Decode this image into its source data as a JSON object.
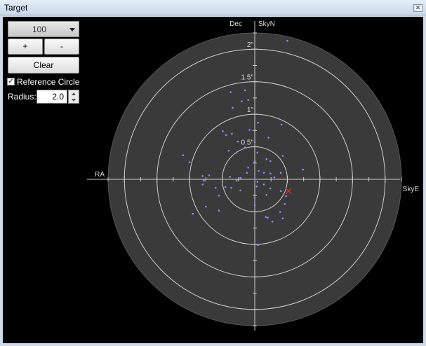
{
  "window": {
    "title": "Target",
    "close_glyph": "✕"
  },
  "controls": {
    "scale_value": "100",
    "plus_label": "+",
    "minus_label": "-",
    "clear_label": "Clear",
    "reference_checked": true,
    "check_glyph": "✓",
    "reference_label": "Reference Circle",
    "radius_label": "Radius:",
    "radius_value": "2.0"
  },
  "colors": {
    "background": "#000000",
    "disk": "#3a3a3a",
    "rings": "#cfcfcf",
    "points": "#8a8aff",
    "marker": "#d03030"
  },
  "plot": {
    "dec_label": "Dec",
    "skyn_label": "SkyN",
    "ra_label": "RA",
    "skye_label": "SkyE",
    "ring_labels": [
      "0.5\"",
      "1\"",
      "1.5\"",
      "2\""
    ],
    "rings": [
      0.5,
      1.0,
      1.5,
      2.0
    ],
    "max_radius": 2.25,
    "marker": {
      "x": 0.52,
      "y": -0.18
    },
    "points": [
      {
        "x": 0.5,
        "y": 2.13
      },
      {
        "x": -0.37,
        "y": 1.34
      },
      {
        "x": -0.15,
        "y": 1.37
      },
      {
        "x": -0.2,
        "y": 1.2
      },
      {
        "x": -0.34,
        "y": 1.1
      },
      {
        "x": -0.1,
        "y": 1.22
      },
      {
        "x": 0.05,
        "y": 0.87
      },
      {
        "x": -0.35,
        "y": 0.7
      },
      {
        "x": -0.49,
        "y": 0.74
      },
      {
        "x": -0.44,
        "y": 0.68
      },
      {
        "x": -0.08,
        "y": 0.76
      },
      {
        "x": 0.21,
        "y": 0.64
      },
      {
        "x": 0.41,
        "y": 0.84
      },
      {
        "x": -0.26,
        "y": 0.58
      },
      {
        "x": -0.15,
        "y": 0.49
      },
      {
        "x": -0.28,
        "y": 0.41
      },
      {
        "x": 0.0,
        "y": 0.57
      },
      {
        "x": -0.4,
        "y": 0.44
      },
      {
        "x": 0.04,
        "y": 0.41
      },
      {
        "x": 0.18,
        "y": 0.31
      },
      {
        "x": 0.24,
        "y": 0.28
      },
      {
        "x": 0.43,
        "y": 0.36
      },
      {
        "x": -1.1,
        "y": 0.37
      },
      {
        "x": -1.0,
        "y": 0.26
      },
      {
        "x": 0.0,
        "y": 0.28
      },
      {
        "x": -0.1,
        "y": 0.18
      },
      {
        "x": 0.74,
        "y": 0.15
      },
      {
        "x": 0.4,
        "y": 0.1
      },
      {
        "x": 0.06,
        "y": 0.13
      },
      {
        "x": 0.14,
        "y": 0.1
      },
      {
        "x": 0.24,
        "y": 0.09
      },
      {
        "x": 0.3,
        "y": 0.03
      },
      {
        "x": -0.12,
        "y": 0.1
      },
      {
        "x": -0.7,
        "y": 0.06
      },
      {
        "x": -0.8,
        "y": 0.05
      },
      {
        "x": -0.38,
        "y": 0.04
      },
      {
        "x": -0.22,
        "y": 0.02
      },
      {
        "x": 0.0,
        "y": 0.0
      },
      {
        "x": -0.78,
        "y": -0.02
      },
      {
        "x": -0.28,
        "y": -0.02
      },
      {
        "x": 0.04,
        "y": -0.04
      },
      {
        "x": 0.14,
        "y": -0.08
      },
      {
        "x": 0.03,
        "y": -0.11
      },
      {
        "x": -0.8,
        "y": -0.08
      },
      {
        "x": -0.6,
        "y": -0.13
      },
      {
        "x": -0.45,
        "y": -0.12
      },
      {
        "x": -0.36,
        "y": -0.13
      },
      {
        "x": -0.22,
        "y": -0.17
      },
      {
        "x": 0.24,
        "y": -0.14
      },
      {
        "x": 0.4,
        "y": -0.18
      },
      {
        "x": -0.55,
        "y": -0.25
      },
      {
        "x": 0.0,
        "y": -0.28
      },
      {
        "x": 0.18,
        "y": -0.24
      },
      {
        "x": 0.48,
        "y": -0.26
      },
      {
        "x": 0.0,
        "y": -0.4
      },
      {
        "x": 0.46,
        "y": -0.38
      },
      {
        "x": -0.75,
        "y": -0.42
      },
      {
        "x": 0.39,
        "y": -0.5
      },
      {
        "x": 0.17,
        "y": -0.58
      },
      {
        "x": -0.55,
        "y": -0.48
      },
      {
        "x": 0.43,
        "y": -0.6
      },
      {
        "x": 0.27,
        "y": -0.65
      },
      {
        "x": -0.95,
        "y": -0.53
      },
      {
        "x": 0.2,
        "y": -0.59
      },
      {
        "x": 0.05,
        "y": -1.01
      }
    ]
  }
}
